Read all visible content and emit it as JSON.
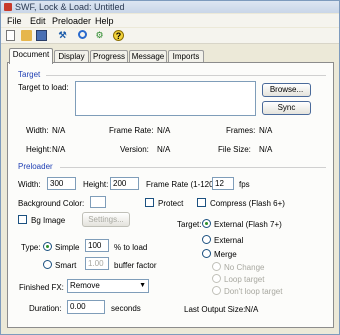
{
  "window": {
    "title": "SWF, Lock & Load: Untitled"
  },
  "menu": [
    "File",
    "Edit",
    "Preloader",
    "Help"
  ],
  "toolbar": {
    "icons": [
      "new-file-icon",
      "open-folder-icon",
      "save-disk-icon",
      "tools-icon",
      "zoom-icon",
      "lock-icon",
      "help-icon"
    ],
    "help_glyph": "?"
  },
  "tabs": [
    "Document",
    "Display",
    "Progress",
    "Message",
    "Imports"
  ],
  "target": {
    "section_title": "Target",
    "target_to_load_label": "Target to load:",
    "target_to_load_value": "",
    "browse_label": "Browse...",
    "sync_label": "Sync",
    "width_label": "Width:",
    "width_value": "N/A",
    "frame_rate_label": "Frame Rate:",
    "frame_rate_value": "N/A",
    "frames_label": "Frames:",
    "frames_value": "N/A",
    "height_label": "Height:",
    "height_value": "N/A",
    "version_label": "Version:",
    "version_value": "N/A",
    "file_size_label": "File Size:",
    "file_size_value": "N/A"
  },
  "preloader": {
    "section_title": "Preloader",
    "width_label": "Width:",
    "width_value": "300",
    "height_label": "Height:",
    "height_value": "200",
    "frame_rate_label": "Frame Rate (1-120):",
    "frame_rate_value": "12",
    "fps_label": "fps",
    "bg_color_label": "Background Color:",
    "bg_color": "#ffffff",
    "protect_label": "Protect",
    "compress_label": "Compress (Flash 6+)",
    "bg_image_label": "Bg Image",
    "settings_label": "Settings...",
    "type_label": "Type:",
    "simple_label": "Simple",
    "simple_value": "100",
    "to_load_label": "% to load",
    "smart_label": "Smart",
    "smart_value": "1.00",
    "buffer_label": "buffer factor",
    "target_label": "Target:",
    "external_flash7_label": "External (Flash 7+)",
    "external_label": "External",
    "merge_label": "Merge",
    "no_change_label": "No Change",
    "loop_target_label": "Loop target",
    "dont_loop_label": "Don't loop target",
    "finished_fx_label": "Finished FX:",
    "finished_fx_value": "Remove",
    "duration_label": "Duration:",
    "duration_value": "0.00",
    "seconds_label": "seconds",
    "last_output_label": "Last Output Size:",
    "last_output_value": "N/A"
  }
}
